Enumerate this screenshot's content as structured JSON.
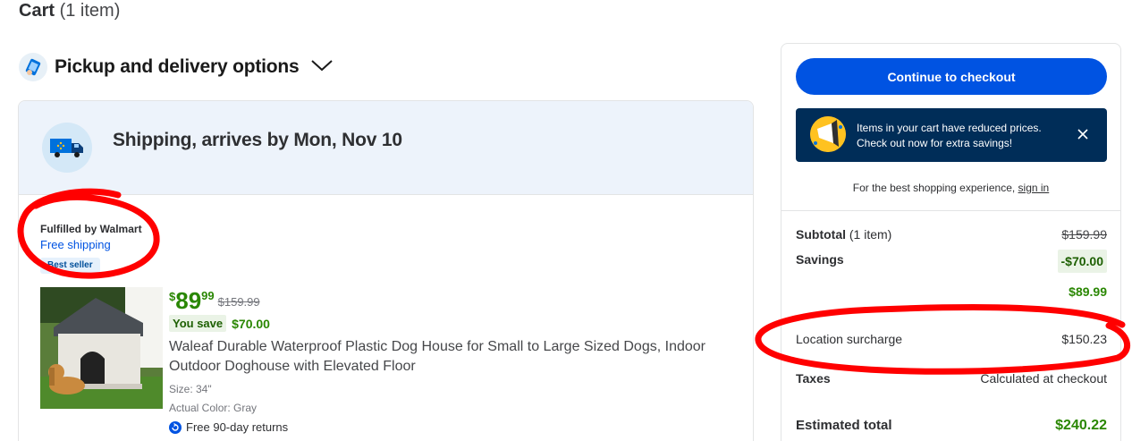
{
  "page": {
    "title": "Cart",
    "item_count": "(1 item)"
  },
  "pickup": {
    "label": "Pickup and delivery options"
  },
  "shipping": {
    "title": "Shipping, arrives by Mon, Nov 10",
    "fulfilled_by": "Fulfilled by Walmart",
    "free_shipping": "Free shipping",
    "badge": "Best seller"
  },
  "product": {
    "price_currency": "$",
    "price_dollars": "89",
    "price_cents": "99",
    "was_price": "$159.99",
    "you_save_label": "You save",
    "you_save_amount": "$70.00",
    "title": "Waleaf Durable Waterproof Plastic Dog House for Small to Large Sized Dogs, Indoor Outdoor Doghouse with Elevated Floor",
    "size": "Size: 34\"",
    "color": "Actual Color: Gray",
    "returns": "Free 90-day returns"
  },
  "summary": {
    "checkout_button": "Continue to checkout",
    "promo_text": "Items in your cart have reduced prices. Check out now for extra savings!",
    "signin_prefix": "For the best shopping experience,",
    "signin_link": "sign in",
    "subtotal_label": "Subtotal",
    "subtotal_count": "(1 item)",
    "subtotal_value": "$159.99",
    "savings_label": "Savings",
    "savings_value": "-$70.00",
    "discounted_value": "$89.99",
    "surcharge_label": "Location surcharge",
    "surcharge_value": "$150.23",
    "taxes_label": "Taxes",
    "taxes_value": "Calculated at checkout",
    "estimated_label": "Estimated total",
    "estimated_value": "$240.22"
  },
  "colors": {
    "brand_blue": "#0053e2",
    "price_green": "#2a8703",
    "promo_navy": "#002d58",
    "annotation_red": "#ff0000"
  },
  "icons": {
    "pickup": "phone-bag-icon",
    "truck": "truck-icon",
    "chevron": "chevron-down-icon",
    "promo": "megaphone-icon",
    "close": "close-icon",
    "returns": "returns-icon"
  }
}
